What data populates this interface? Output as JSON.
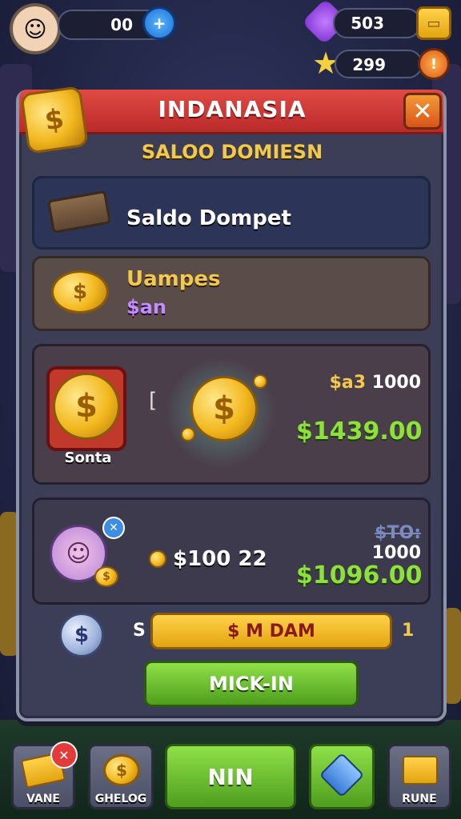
{
  "hud": {
    "left_value": "00",
    "top_right_value": "503",
    "second_right_value": "299"
  },
  "dialog": {
    "title": "INDANASIA",
    "subtitle": "SALOO DOMIESN",
    "close_label": "✕"
  },
  "rows": {
    "wallet_label": "Saldo Dompet",
    "deposit_title": "Uampes",
    "deposit_sub": "$an",
    "reward1_badge": "Sonta",
    "reward1_mid": "[",
    "reward1_top_prefix": "$a3",
    "reward1_top_value": "1000",
    "reward1_amount": "$1439.00",
    "reward2_coin_text": "$100 22",
    "reward2_top_prefix": "$TO:",
    "reward2_top_value": "1000",
    "reward2_amount": "$1096.00"
  },
  "actions": {
    "slider_left": "S",
    "slider_label": "$ M DAM",
    "slider_right": "1",
    "green_button": "MICK-IN"
  },
  "bottom_nav": {
    "btn1": "VANE",
    "btn2": "GHELOG",
    "btn3": "NIN",
    "btn4": "",
    "btn5": "RUNE"
  },
  "colors": {
    "accent_red": "#d43a36",
    "gold": "#f2c94c",
    "green": "#7ccf3a",
    "panel": "#3c3e57"
  }
}
